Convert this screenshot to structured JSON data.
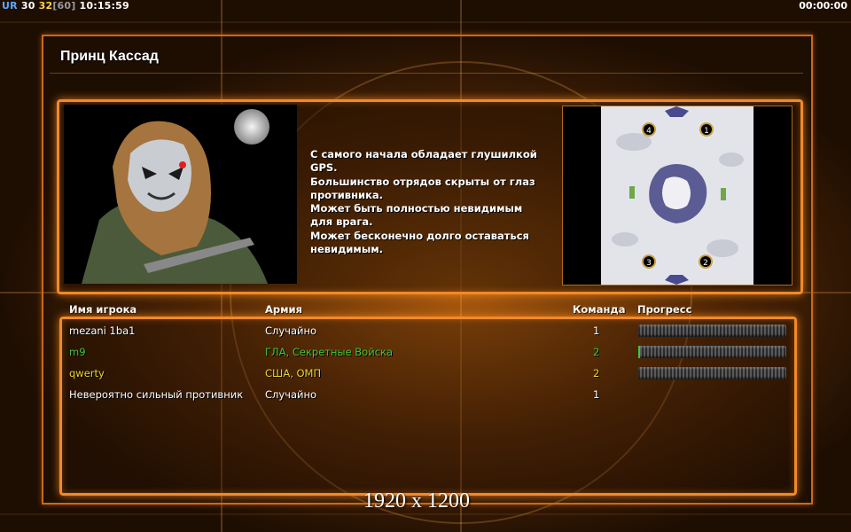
{
  "hud": {
    "ur_label": "UR",
    "fps1": "30",
    "fps2": "32",
    "fps_cap": "[60]",
    "clock": "10:15:59",
    "timer": "00:00:00"
  },
  "title": "Принц Кассад",
  "description": "С самого начала обладает глушилкой GPS.\nБольшинство отрядов скрыты от глаз\n противника.\nМожет быть полностью невидимым\nдля врага.\nМожет бесконечно долго оставаться\n невидимым.",
  "map": {
    "start_positions": [
      "4",
      "1",
      "3",
      "2"
    ]
  },
  "table": {
    "headers": {
      "player": "Имя игрока",
      "army": "Армия",
      "team": "Команда",
      "progress": "Прогресс"
    },
    "rows": [
      {
        "name": "mezani 1ba1",
        "army": "Случайно",
        "team": "1",
        "color": "#ffffff",
        "progress": 0.0,
        "show_progress": true
      },
      {
        "name": "m9",
        "army": "ГЛА, Секретные Войска",
        "team": "2",
        "color": "#3ec83e",
        "progress": 0.01,
        "show_progress": true
      },
      {
        "name": "qwerty",
        "army": "США, ОМП",
        "team": "2",
        "color": "#e8d430",
        "progress": 0.0,
        "show_progress": true
      },
      {
        "name": "Невероятно сильный противник",
        "army": "Случайно",
        "team": "1",
        "color": "#ffffff",
        "show_progress": false
      }
    ]
  },
  "resolution": "1920 x 1200",
  "colors": {
    "accent": "#f08a2a",
    "team_green": "#3ec83e",
    "team_yellow": "#e8d430"
  }
}
